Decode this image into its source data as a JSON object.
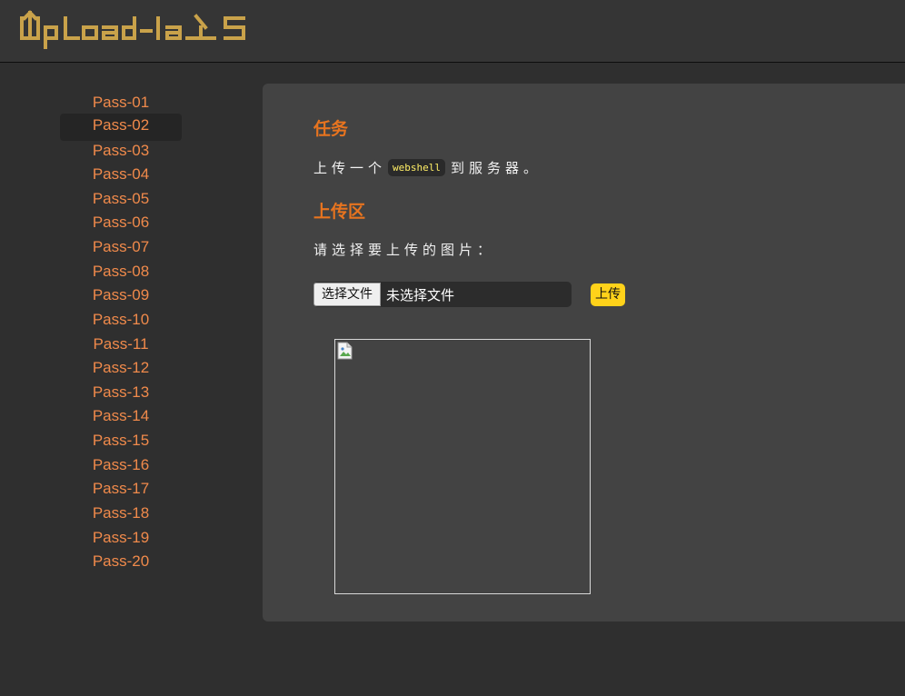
{
  "header": {
    "logo_text": "UpLoad-labS",
    "logo_color": "#c9a24a"
  },
  "sidebar": {
    "items": [
      {
        "label": "Pass-01"
      },
      {
        "label": "Pass-02"
      },
      {
        "label": "Pass-03"
      },
      {
        "label": "Pass-04"
      },
      {
        "label": "Pass-05"
      },
      {
        "label": "Pass-06"
      },
      {
        "label": "Pass-07"
      },
      {
        "label": "Pass-08"
      },
      {
        "label": "Pass-09"
      },
      {
        "label": "Pass-10"
      },
      {
        "label": "Pass-11"
      },
      {
        "label": "Pass-12"
      },
      {
        "label": "Pass-13"
      },
      {
        "label": "Pass-14"
      },
      {
        "label": "Pass-15"
      },
      {
        "label": "Pass-16"
      },
      {
        "label": "Pass-17"
      },
      {
        "label": "Pass-18"
      },
      {
        "label": "Pass-19"
      },
      {
        "label": "Pass-20"
      }
    ],
    "active_label": "Pass-02",
    "item_color": "#f08a4b"
  },
  "main": {
    "task_title": "任务",
    "task_text_before": "上传一个",
    "task_code": "webshell",
    "task_text_after": "到服务器。",
    "upload_title": "上传区",
    "choose_prompt": "请选择要上传的图片：",
    "file_button_label": "选择文件",
    "file_status": "未选择文件",
    "upload_button_label": "上传",
    "accent_color": "#e8741f",
    "upload_button_color": "#ffd21a"
  },
  "icons": {
    "preview": "broken-image-icon"
  }
}
